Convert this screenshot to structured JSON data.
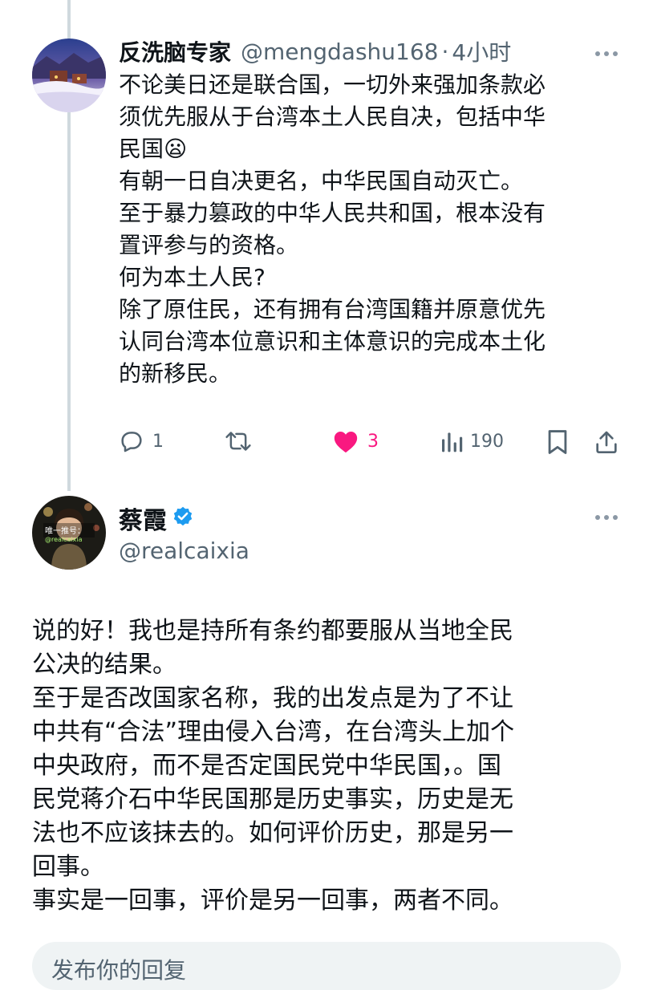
{
  "quoted_tweet": {
    "display_name": "反洗脑专家",
    "handle": "@mengdashu168",
    "separator": "·",
    "time": "4小时",
    "text": "不论美日还是联合国，一切外来强加条款必\n须优先服从于台湾本土人民自决，包括中华\n民国😦\n有朝一日自决更名，中华民国自动灭亡。\n至于暴力篡政的中华人民共和国，根本没有\n置评参与的资格。\n何为本土人民?\n除了原住民，还有拥有台湾国籍并原意优先\n认同台湾本位意识和主体意识的完成本土化\n的新移民。",
    "reply_count": "1",
    "like_count": "3",
    "view_count": "190",
    "like_color": "#f91880"
  },
  "main_tweet": {
    "display_name": "蔡霞",
    "handle": "@realcaixia",
    "avatar_overlay_text": "唯一推号：",
    "avatar_overlay_handle": "@realcaixia",
    "text": "说的好！我也是持所有条约都要服从当地全民\n公决的结果。\n至于是否改国家名称，我的出发点是为了不让\n中共有“合法”理由侵入台湾，在台湾头上加个\n中央政府，而不是否定国民党中华民国，。国\n民党蒋介石中华民国那是历史事实，历史是无\n法也不应该抹去的。如何评价历史，那是另一\n回事。\n事实是一回事，评价是另一回事，两者不同。",
    "verified_color": "#1d9bf0"
  },
  "reply_bar": {
    "placeholder": "发布你的回复"
  }
}
